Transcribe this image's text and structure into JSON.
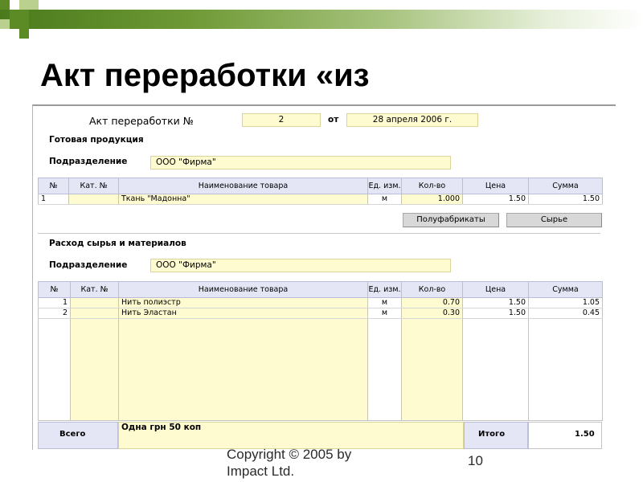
{
  "slide": {
    "title": "Акт переработки «из",
    "copyright": "Copyright © 2005 by Impact Ltd.",
    "page_number": "10"
  },
  "form": {
    "act_label": "Акт переработки №",
    "act_number": "2",
    "from_label": "от",
    "date": "28 апреля 2006 г.",
    "finished_section": {
      "heading": "Готовая продукция",
      "department_label": "Подразделение",
      "department_value": "ООО \"Фирма\"",
      "columns": [
        "№",
        "Кат. №",
        "Наименование товара",
        "Ед. изм.",
        "Кол-во",
        "Цена",
        "Сумма"
      ],
      "rows": [
        {
          "n": "1",
          "cat": "",
          "name": "Ткань \"Мадонна\"",
          "unit": "м",
          "qty": "1.000",
          "price": "1.50",
          "sum": "1.50"
        }
      ]
    },
    "buttons": {
      "semi_products": "Полуфабрикаты",
      "raw": "Сырье"
    },
    "raw_section": {
      "heading": "Расход сырья и материалов",
      "department_label": "Подразделение",
      "department_value": "ООО \"Фирма\"",
      "columns": [
        "№",
        "Кат. №",
        "Наименование товара",
        "Ед. изм.",
        "Кол-во",
        "Цена",
        "Сумма"
      ],
      "rows": [
        {
          "n": "1",
          "cat": "",
          "name": "Нить полиэстр",
          "unit": "м",
          "qty": "0.70",
          "price": "1.50",
          "sum": "1.05"
        },
        {
          "n": "2",
          "cat": "",
          "name": "Нить Эластан",
          "unit": "м",
          "qty": "0.30",
          "price": "1.50",
          "sum": "0.45"
        }
      ]
    },
    "footer": {
      "total_label": "Всего",
      "amount_words": "Одна грн 50 коп",
      "itogo_label": "Итого",
      "itogo_value": "1.50"
    }
  }
}
